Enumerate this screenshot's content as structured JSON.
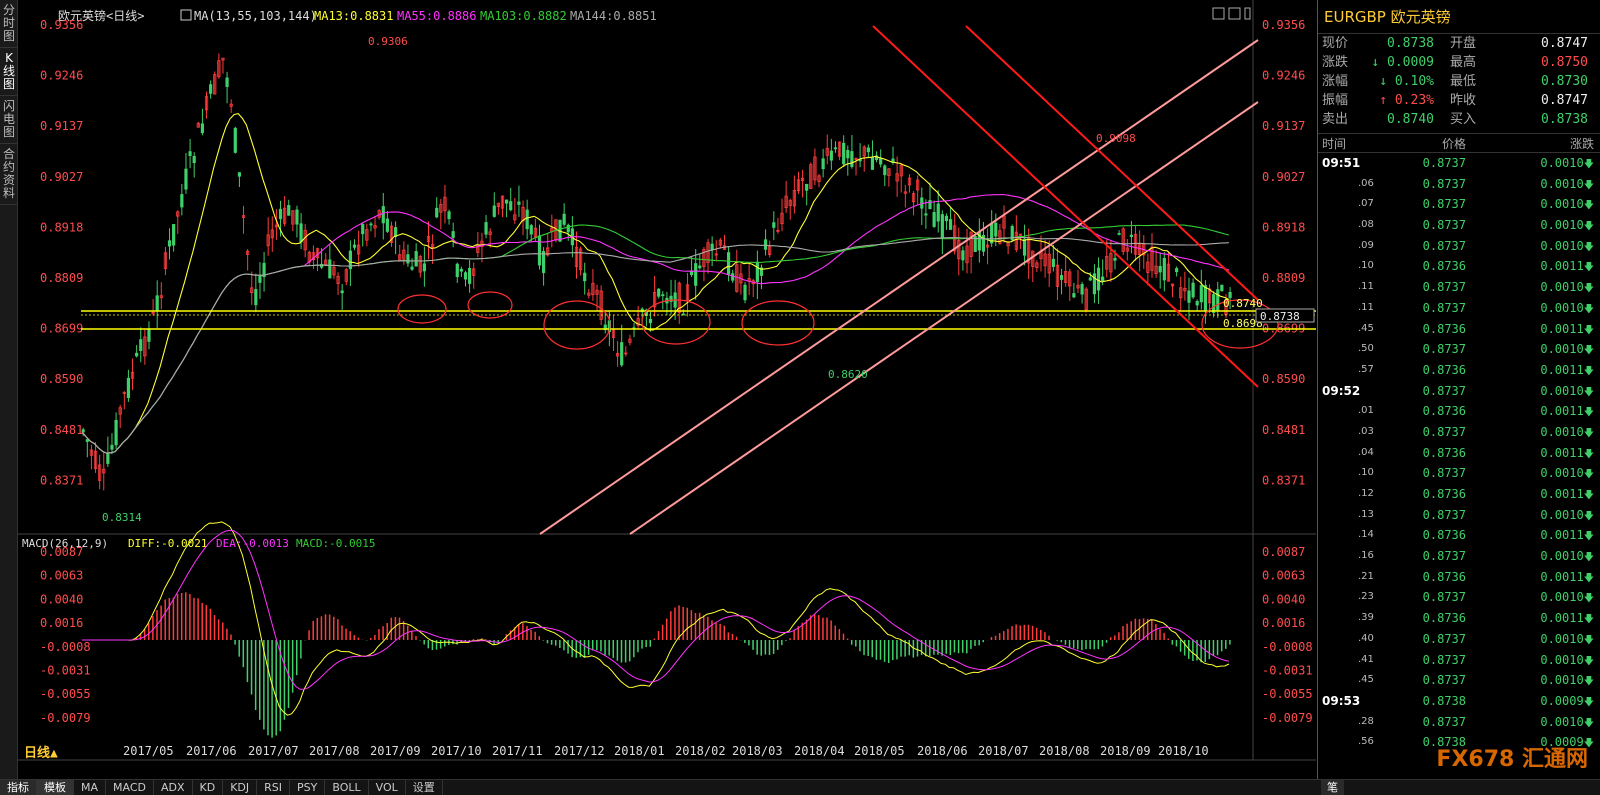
{
  "left_tabs": [
    "分时图",
    "K线图",
    "闪电图",
    "合约资料"
  ],
  "chart": {
    "title": "欧元英镑<日线>",
    "ma_legend": "MA(13,55,103,144)",
    "ma13": "MA13:0.8831",
    "ma55": "MA55:0.8886",
    "ma103": "MA103:0.8882",
    "ma144": "MA144:0.8851",
    "colors": {
      "up": "#ff3b3b",
      "down": "#3fd06a",
      "ma13": "#ffff33",
      "ma55": "#ff33ff",
      "ma103": "#33cc33",
      "ma144": "#aaaaaa",
      "yellow_line": "#ffff00",
      "channel": "#ff9a9a",
      "down_channel": "#ff1a1a"
    },
    "price_ticks": [
      "0.9356",
      "0.9246",
      "0.9137",
      "0.9027",
      "0.8918",
      "0.8809",
      "0.8699",
      "0.8590",
      "0.8481",
      "0.8371"
    ],
    "annotations": {
      "high": "0.9306",
      "high2": "0.9098",
      "low": "0.8314",
      "low2": "0.8620",
      "lvl1": "0.8740",
      "lvl2": "0.8698",
      "last": "0.8738"
    },
    "macd_legend": "MACD(26,12,9)",
    "diff": "DIFF:-0.0021",
    "dea": "DEA:-0.0013",
    "macd": "MACD:-0.0015",
    "macd_ticks": [
      "0.0087",
      "0.0063",
      "0.0040",
      "0.0016",
      "-0.0008",
      "-0.0031",
      "-0.0055",
      "-0.0079"
    ],
    "date_labels": [
      "2017/05",
      "2017/06",
      "2017/07",
      "2017/08",
      "2017/09",
      "2017/10",
      "2017/11",
      "2017/12",
      "2018/01",
      "2018/02",
      "2018/03",
      "2018/04",
      "2018/05",
      "2018/06",
      "2018/07",
      "2018/08",
      "2018/09",
      "2018/10"
    ],
    "period_label": "日线▲"
  },
  "bottom_tabs": [
    "指标",
    "模板",
    "MA",
    "MACD",
    "ADX",
    "KD",
    "KDJ",
    "RSI",
    "PSY",
    "BOLL",
    "VOL",
    "设置"
  ],
  "pen_label": "笔",
  "quote": {
    "title": "EURGBP 欧元英镑",
    "rows": [
      {
        "l1": "现价",
        "v1": "0.8738",
        "c1": "green",
        "l2": "开盘",
        "v2": "0.8747",
        "c2": "white"
      },
      {
        "l1": "涨跌",
        "v1": "↓ 0.0009",
        "c1": "green",
        "l2": "最高",
        "v2": "0.8750",
        "c2": "red"
      },
      {
        "l1": "涨幅",
        "v1": "↓ 0.10%",
        "c1": "green",
        "l2": "最低",
        "v2": "0.8730",
        "c2": "green"
      },
      {
        "l1": "振幅",
        "v1": "↑ 0.23%",
        "c1": "red",
        "l2": "昨收",
        "v2": "0.8747",
        "c2": "white"
      },
      {
        "l1": "卖出",
        "v1": "0.8740",
        "c1": "green",
        "l2": "买入",
        "v2": "0.8738",
        "c2": "green"
      }
    ],
    "tick_headers": [
      "时间",
      "价格",
      "涨跌"
    ],
    "ticks": [
      {
        "t": "09:51",
        "p": "0.8737",
        "c": "0.0010",
        "min": true
      },
      {
        "t": ".06",
        "p": "0.8737",
        "c": "0.0010"
      },
      {
        "t": ".07",
        "p": "0.8737",
        "c": "0.0010"
      },
      {
        "t": ".08",
        "p": "0.8737",
        "c": "0.0010"
      },
      {
        "t": ".09",
        "p": "0.8737",
        "c": "0.0010"
      },
      {
        "t": ".10",
        "p": "0.8736",
        "c": "0.0011"
      },
      {
        "t": ".11",
        "p": "0.8737",
        "c": "0.0010"
      },
      {
        "t": ".11",
        "p": "0.8737",
        "c": "0.0010"
      },
      {
        "t": ".45",
        "p": "0.8736",
        "c": "0.0011"
      },
      {
        "t": ".50",
        "p": "0.8737",
        "c": "0.0010"
      },
      {
        "t": ".57",
        "p": "0.8736",
        "c": "0.0011"
      },
      {
        "t": "09:52",
        "p": "0.8737",
        "c": "0.0010",
        "min": true
      },
      {
        "t": ".01",
        "p": "0.8736",
        "c": "0.0011"
      },
      {
        "t": ".03",
        "p": "0.8737",
        "c": "0.0010"
      },
      {
        "t": ".04",
        "p": "0.8736",
        "c": "0.0011"
      },
      {
        "t": ".10",
        "p": "0.8737",
        "c": "0.0010"
      },
      {
        "t": ".12",
        "p": "0.8736",
        "c": "0.0011"
      },
      {
        "t": ".13",
        "p": "0.8737",
        "c": "0.0010"
      },
      {
        "t": ".14",
        "p": "0.8736",
        "c": "0.0011"
      },
      {
        "t": ".16",
        "p": "0.8737",
        "c": "0.0010"
      },
      {
        "t": ".21",
        "p": "0.8736",
        "c": "0.0011"
      },
      {
        "t": ".23",
        "p": "0.8737",
        "c": "0.0010"
      },
      {
        "t": ".39",
        "p": "0.8736",
        "c": "0.0011"
      },
      {
        "t": ".40",
        "p": "0.8737",
        "c": "0.0010"
      },
      {
        "t": ".41",
        "p": "0.8737",
        "c": "0.0010"
      },
      {
        "t": ".45",
        "p": "0.8737",
        "c": "0.0010"
      },
      {
        "t": "09:53",
        "p": "0.8738",
        "c": "0.0009",
        "min": true
      },
      {
        "t": ".28",
        "p": "0.8737",
        "c": "0.0010"
      },
      {
        "t": ".56",
        "p": "0.8738",
        "c": "0.0009"
      }
    ],
    "watermark": "FX678 汇通网"
  }
}
